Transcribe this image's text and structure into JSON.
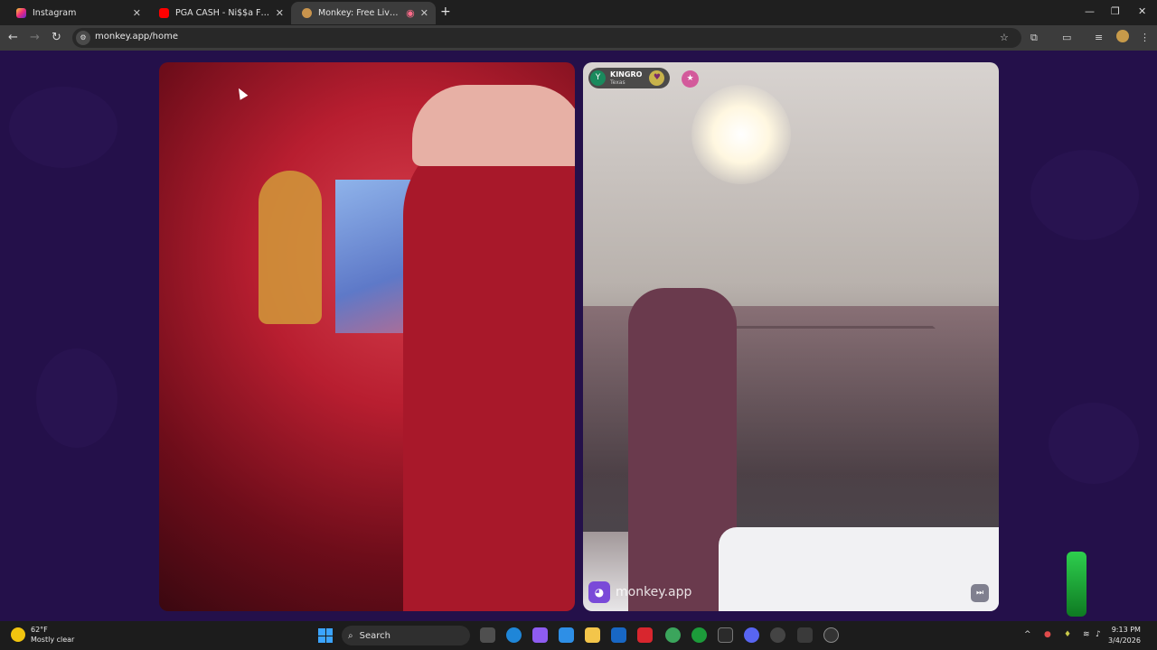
{
  "browser": {
    "tabs": [
      {
        "label": "Instagram",
        "icon": "instagram-icon",
        "active": false
      },
      {
        "label": "PGA CASH - Ni$$a F__k You Fr",
        "icon": "youtube-icon",
        "active": false
      },
      {
        "label": "Monkey: Free Live Video Ch",
        "icon": "monkey-icon",
        "active": true
      }
    ],
    "url": "monkey.app/home"
  },
  "call": {
    "peer": {
      "name": "KINGRO",
      "location": "Texas",
      "avatar_letter": "Y"
    },
    "watermark": "monkey.app"
  },
  "taskbar": {
    "weather_temp": "62°F",
    "weather_desc": "Mostly clear",
    "search_label": "Search",
    "time": "9:13 PM",
    "date": "3/4/2026"
  },
  "colors": {
    "background": "#24104a",
    "accent": "#7a4ad8"
  }
}
